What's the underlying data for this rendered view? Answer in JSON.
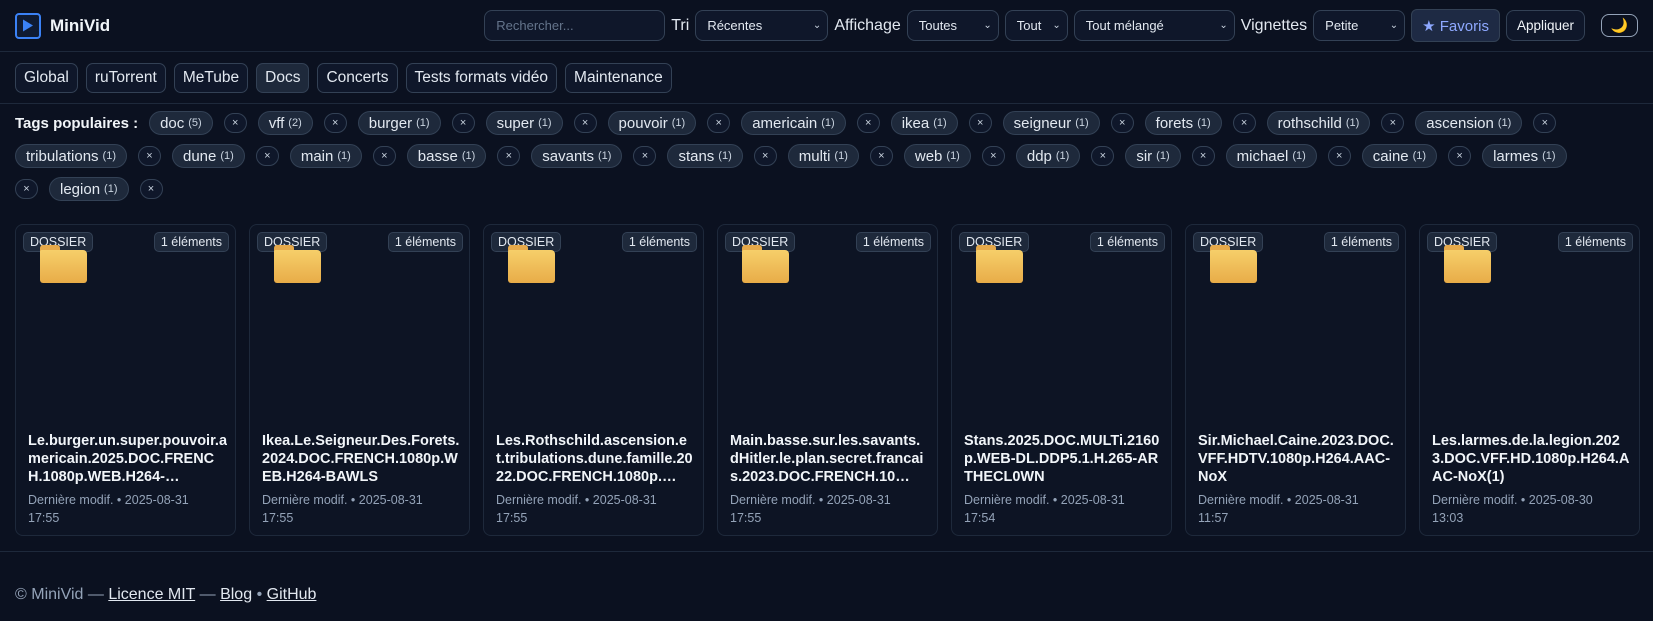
{
  "app": {
    "name": "MiniVid"
  },
  "toolbar": {
    "search_placeholder": "Rechercher...",
    "sort_label": "Tri",
    "sort_value": "Récentes",
    "display_label": "Affichage",
    "display_value": "Toutes",
    "type_value": "Tout",
    "order_value": "Tout mélangé",
    "thumbs_label": "Vignettes",
    "thumbs_value": "Petite",
    "favorites_label": "★ Favoris",
    "apply_label": "Appliquer",
    "theme_icon": "🌙"
  },
  "tabs": [
    {
      "label": "Global"
    },
    {
      "label": "ruTorrent"
    },
    {
      "label": "MeTube"
    },
    {
      "label": "Docs"
    },
    {
      "label": "Concerts"
    },
    {
      "label": "Tests formats vidéo"
    },
    {
      "label": "Maintenance"
    }
  ],
  "active_tab": "Docs",
  "tags": {
    "label": "Tags populaires :",
    "remove_symbol": "×",
    "items": [
      {
        "name": "doc",
        "count": "(5)"
      },
      {
        "name": "vff",
        "count": "(2)"
      },
      {
        "name": "burger",
        "count": "(1)"
      },
      {
        "name": "super",
        "count": "(1)"
      },
      {
        "name": "pouvoir",
        "count": "(1)"
      },
      {
        "name": "americain",
        "count": "(1)"
      },
      {
        "name": "ikea",
        "count": "(1)"
      },
      {
        "name": "seigneur",
        "count": "(1)"
      },
      {
        "name": "forets",
        "count": "(1)"
      },
      {
        "name": "rothschild",
        "count": "(1)"
      },
      {
        "name": "ascension",
        "count": "(1)"
      },
      {
        "name": "tribulations",
        "count": "(1)"
      },
      {
        "name": "dune",
        "count": "(1)"
      },
      {
        "name": "main",
        "count": "(1)"
      },
      {
        "name": "basse",
        "count": "(1)"
      },
      {
        "name": "savants",
        "count": "(1)"
      },
      {
        "name": "stans",
        "count": "(1)"
      },
      {
        "name": "multi",
        "count": "(1)"
      },
      {
        "name": "web",
        "count": "(1)"
      },
      {
        "name": "ddp",
        "count": "(1)"
      },
      {
        "name": "sir",
        "count": "(1)"
      },
      {
        "name": "michael",
        "count": "(1)"
      },
      {
        "name": "caine",
        "count": "(1)"
      },
      {
        "name": "larmes",
        "count": "(1)"
      },
      {
        "name": "legion",
        "count": "(1)"
      }
    ]
  },
  "folders": [
    {
      "type": "DOSSIER",
      "count": "1 éléments",
      "title": "Le.burger.un.super.pouvoir.americain.2025.DOC.FRENCH.1080p.WEB.H264-…",
      "meta_label": "Dernière modif. •",
      "date": "2025-08-31",
      "time": "17:55"
    },
    {
      "type": "DOSSIER",
      "count": "1 éléments",
      "title": "Ikea.Le.Seigneur.Des.Forets.2024.DOC.FRENCH.1080p.WEB.H264-BAWLS",
      "meta_label": "Dernière modif. •",
      "date": "2025-08-31",
      "time": "17:55"
    },
    {
      "type": "DOSSIER",
      "count": "1 éléments",
      "title": "Les.Rothschild.ascension.et.tribulations.dune.famille.2022.DOC.FRENCH.1080p.…",
      "meta_label": "Dernière modif. •",
      "date": "2025-08-31",
      "time": "17:55"
    },
    {
      "type": "DOSSIER",
      "count": "1 éléments",
      "title": "Main.basse.sur.les.savants.dHitler.le.plan.secret.francais.2023.DOC.FRENCH.10…",
      "meta_label": "Dernière modif. •",
      "date": "2025-08-31",
      "time": "17:55"
    },
    {
      "type": "DOSSIER",
      "count": "1 éléments",
      "title": "Stans.2025.DOC.MULTi.2160p.WEB-DL.DDP5.1.H.265-ARTHECL0WN",
      "meta_label": "Dernière modif. •",
      "date": "2025-08-31",
      "time": "17:54"
    },
    {
      "type": "DOSSIER",
      "count": "1 éléments",
      "title": "Sir.Michael.Caine.2023.DOC.VFF.HDTV.1080p.H264.AAC-NoX",
      "meta_label": "Dernière modif. •",
      "date": "2025-08-31",
      "time": "11:57"
    },
    {
      "type": "DOSSIER",
      "count": "1 éléments",
      "title": "Les.larmes.de.la.legion.2023.DOC.VFF.HD.1080p.H264.AAC-NoX(1)",
      "meta_label": "Dernière modif. •",
      "date": "2025-08-30",
      "time": "13:03"
    }
  ],
  "footer": {
    "copyright": "© MiniVid —",
    "licence": "Licence MIT",
    "dash": "—",
    "blog": "Blog",
    "bullet": "•",
    "github": "GitHub"
  },
  "colors": {
    "background": "#0b1120",
    "accent": "#3b82f6",
    "favorites": "#8ea8ff",
    "folder": "#f6cf6a"
  }
}
